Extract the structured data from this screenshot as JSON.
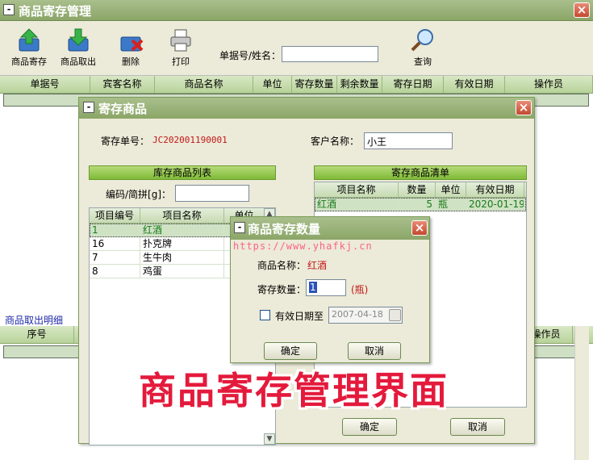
{
  "main": {
    "title": "商品寄存管理",
    "toolbar": {
      "deposit": "商品寄存",
      "withdraw": "商品取出",
      "delete": "删除",
      "print": "打印",
      "search_label": "单据号/姓名：",
      "search_value": "",
      "query": "查询"
    },
    "grid_columns": [
      "单据号",
      "宾客名称",
      "商品名称",
      "单位",
      "寄存数量",
      "剩余数量",
      "寄存日期",
      "有效日期",
      "操作员"
    ],
    "detail_label": "商品取出明细",
    "detail_columns": [
      "序号",
      "操作员"
    ]
  },
  "dialog1": {
    "title": "寄存商品",
    "order_label": "寄存单号：",
    "order_no": "JC202001190001",
    "customer_label": "客户名称：",
    "customer_value": "小王",
    "stock_header": "库存商品列表",
    "filter_label": "编码/简拼[g]：",
    "filter_value": "",
    "stock_columns": [
      "项目编号",
      "项目名称",
      "单位"
    ],
    "stock_rows": [
      {
        "code": "1",
        "name": "红酒",
        "unit": ""
      },
      {
        "code": "16",
        "name": "扑克牌",
        "unit": ""
      },
      {
        "code": "7",
        "name": "生牛肉",
        "unit": ""
      },
      {
        "code": "8",
        "name": "鸡蛋",
        "unit": ""
      }
    ],
    "deposit_header": "寄存商品清单",
    "deposit_columns": [
      "项目名称",
      "数量",
      "单位",
      "有效日期"
    ],
    "deposit_rows": [
      {
        "name": "红酒",
        "qty": "5",
        "unit": "瓶",
        "date": "2020-01-19"
      }
    ],
    "ok": "确定",
    "cancel": "取消"
  },
  "dialog2": {
    "title": "商品寄存数量",
    "name_label": "商品名称：",
    "name_value": "红酒",
    "qty_label": "寄存数量：",
    "qty_value": "1",
    "qty_unit": "(瓶)",
    "expiry_label": "有效日期至",
    "expiry_value": "2007-04-18",
    "ok": "确定",
    "cancel": "取消"
  },
  "overlay": {
    "watermark_url": "https://www.yhafkj.cn",
    "caption": "商品寄存管理界面"
  },
  "colors": {
    "title_bar": "#8ba668",
    "accent_red": "#e41a3c",
    "selected_green": "#1a7a1a"
  },
  "icons": {
    "deposit": "box-up-arrow-icon",
    "withdraw": "box-down-arrow-icon",
    "delete": "box-delete-icon",
    "print": "printer-icon",
    "query": "magnifier-icon"
  }
}
